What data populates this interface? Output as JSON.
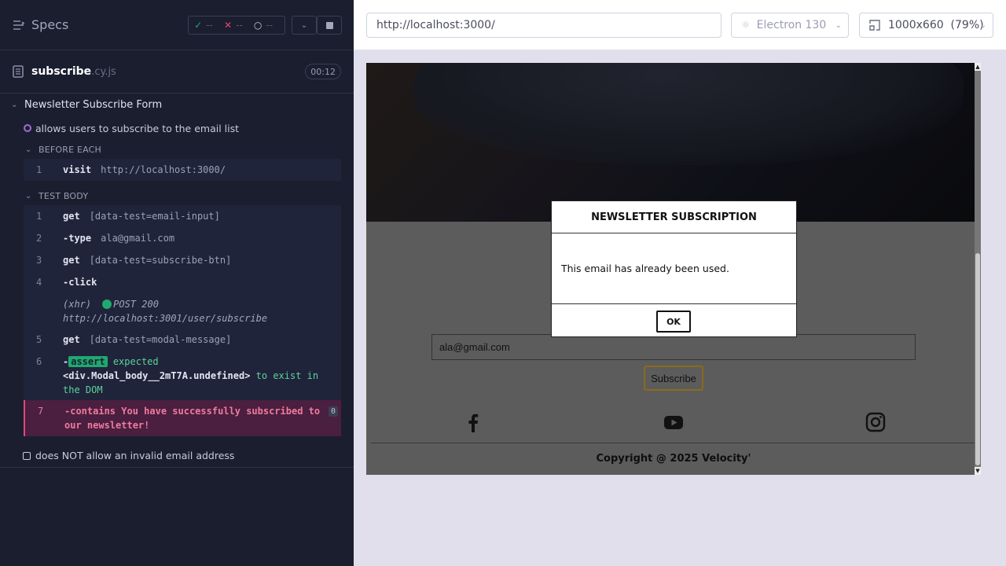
{
  "reporter": {
    "header": {
      "title": "Specs",
      "stats": {
        "passed": "--",
        "failed": "--",
        "pending": "--"
      }
    },
    "spec": {
      "name": "subscribe",
      "ext": ".cy.js",
      "duration": "00:12"
    },
    "suite": {
      "title": "Newsletter Subscribe Form"
    },
    "test1": {
      "title": "allows users to subscribe to the email list",
      "before_each_label": "BEFORE EACH",
      "before_each_cmds": [
        {
          "num": "1",
          "name": "visit",
          "message": "http://localhost:3000/"
        }
      ],
      "test_body_label": "TEST BODY",
      "cmds": [
        {
          "num": "1",
          "name": "get",
          "message": "[data-test=email-input]"
        },
        {
          "num": "2",
          "name": "-type",
          "message": "ala@gmail.com"
        },
        {
          "num": "3",
          "name": "get",
          "message": "[data-test=subscribe-btn]"
        },
        {
          "num": "4",
          "name": "-click",
          "message": ""
        },
        {
          "num": "5",
          "name": "get",
          "message": "[data-test=modal-message]"
        },
        {
          "num": "6",
          "name": "-",
          "message": ""
        },
        {
          "num": "7",
          "name": "-contains",
          "message": "You have successfully subscribed to our newsletter!"
        }
      ],
      "xhr": {
        "tag": "(xhr)",
        "method_status": "POST 200",
        "url": "http://localhost:3001/user/subscribe"
      },
      "assert": {
        "badge": "assert",
        "expected": "expected",
        "element": "<div.Modal_body__2mT7A.undefined>",
        "tail": "to exist in the DOM"
      },
      "fail_count": "0"
    },
    "test2": {
      "title": "does NOT allow an invalid email address"
    }
  },
  "topbar": {
    "url": "http://localhost:3000/",
    "browser": "Electron 130",
    "viewport": "1000x660",
    "zoom": "(79%)"
  },
  "aut": {
    "email_value": "ala@gmail.com",
    "subscribe_label": "Subscribe",
    "copyright": "Copyright @ 2025 Velocity'",
    "modal": {
      "title": "NEWSLETTER SUBSCRIPTION",
      "message": "This email has already been used.",
      "ok_label": "OK"
    }
  },
  "colors": {
    "pass": "#1fa971",
    "fail": "#e2487a",
    "running": "#a06cd5",
    "reporter_bg": "#1b1e2e"
  }
}
